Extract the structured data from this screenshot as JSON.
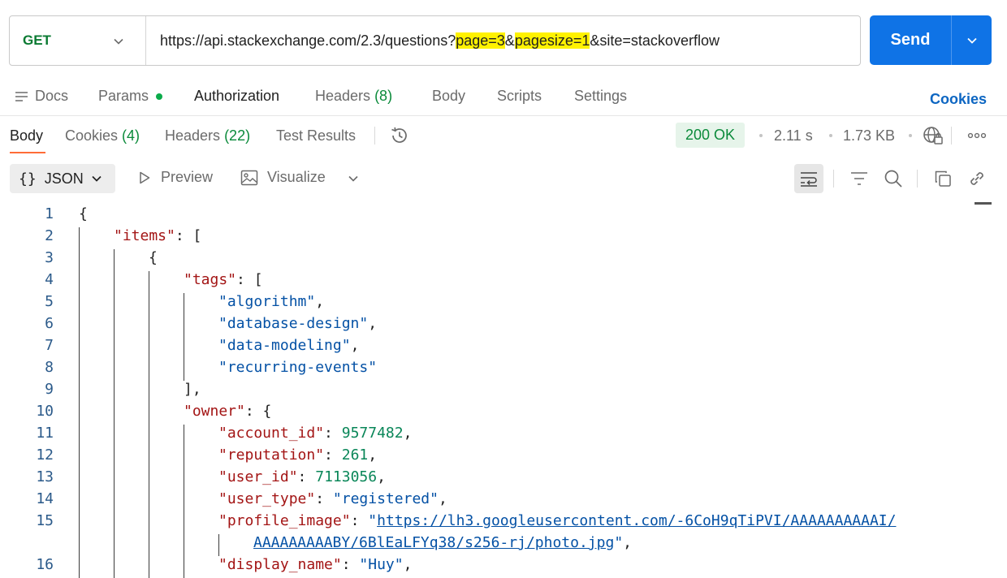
{
  "request": {
    "method": "GET",
    "url_parts": [
      {
        "text": "https://api.stackexchange.com/2.3/questions?",
        "hl": false
      },
      {
        "text": "page=3",
        "hl": true
      },
      {
        "text": "&",
        "hl": false
      },
      {
        "text": "pagesize=1",
        "hl": true
      },
      {
        "text": "&site=stackoverflow",
        "hl": false
      }
    ],
    "send_label": "Send"
  },
  "request_tabs": {
    "docs": "Docs",
    "params": "Params",
    "authorization": "Authorization",
    "headers": "Headers",
    "headers_count": "(8)",
    "body": "Body",
    "scripts": "Scripts",
    "settings": "Settings",
    "cookies": "Cookies"
  },
  "response_tabs": {
    "body": "Body",
    "cookies": "Cookies",
    "cookies_count": "(4)",
    "headers": "Headers",
    "headers_count": "(22)",
    "test_results": "Test Results"
  },
  "status": {
    "code": "200 OK",
    "time": "2.11 s",
    "size": "1.73 KB"
  },
  "toolbar": {
    "format": "JSON",
    "preview": "Preview",
    "visualize": "Visualize"
  },
  "colors": {
    "accent": "#0f73e6",
    "status_ok": "#0a8a3a",
    "highlight": "#fff200",
    "active_tab": "#ff6c37"
  },
  "code_lines": [
    {
      "n": "1",
      "depth": 0,
      "tokens": [
        [
          "p",
          "{"
        ]
      ]
    },
    {
      "n": "2",
      "depth": 1,
      "tokens": [
        [
          "k",
          "\"items\""
        ],
        [
          "p",
          ": ["
        ]
      ]
    },
    {
      "n": "3",
      "depth": 2,
      "tokens": [
        [
          "p",
          "{"
        ]
      ]
    },
    {
      "n": "4",
      "depth": 3,
      "tokens": [
        [
          "k",
          "\"tags\""
        ],
        [
          "p",
          ": ["
        ]
      ]
    },
    {
      "n": "5",
      "depth": 4,
      "tokens": [
        [
          "s",
          "\"algorithm\""
        ],
        [
          "p",
          ","
        ]
      ]
    },
    {
      "n": "6",
      "depth": 4,
      "tokens": [
        [
          "s",
          "\"database-design\""
        ],
        [
          "p",
          ","
        ]
      ]
    },
    {
      "n": "7",
      "depth": 4,
      "tokens": [
        [
          "s",
          "\"data-modeling\""
        ],
        [
          "p",
          ","
        ]
      ]
    },
    {
      "n": "8",
      "depth": 4,
      "tokens": [
        [
          "s",
          "\"recurring-events\""
        ]
      ]
    },
    {
      "n": "9",
      "depth": 3,
      "tokens": [
        [
          "p",
          "],"
        ]
      ]
    },
    {
      "n": "10",
      "depth": 3,
      "tokens": [
        [
          "k",
          "\"owner\""
        ],
        [
          "p",
          ": {"
        ]
      ]
    },
    {
      "n": "11",
      "depth": 4,
      "tokens": [
        [
          "k",
          "\"account_id\""
        ],
        [
          "p",
          ": "
        ],
        [
          "n",
          "9577482"
        ],
        [
          "p",
          ","
        ]
      ]
    },
    {
      "n": "12",
      "depth": 4,
      "tokens": [
        [
          "k",
          "\"reputation\""
        ],
        [
          "p",
          ": "
        ],
        [
          "n",
          "261"
        ],
        [
          "p",
          ","
        ]
      ]
    },
    {
      "n": "13",
      "depth": 4,
      "tokens": [
        [
          "k",
          "\"user_id\""
        ],
        [
          "p",
          ": "
        ],
        [
          "n",
          "7113056"
        ],
        [
          "p",
          ","
        ]
      ]
    },
    {
      "n": "14",
      "depth": 4,
      "tokens": [
        [
          "k",
          "\"user_type\""
        ],
        [
          "p",
          ": "
        ],
        [
          "s",
          "\"registered\""
        ],
        [
          "p",
          ","
        ]
      ]
    },
    {
      "n": "15",
      "depth": 4,
      "tokens": [
        [
          "k",
          "\"profile_image\""
        ],
        [
          "p",
          ": "
        ],
        [
          "s",
          "\""
        ],
        [
          "u",
          "https://lh3.googleusercontent.com/-6CoH9qTiPVI/AAAAAAAAAAI/"
        ]
      ]
    },
    {
      "n": "",
      "depth": 5,
      "tokens": [
        [
          "u",
          "AAAAAAAAABY/6BlEaLFYq38/s256-rj/photo.jpg"
        ],
        [
          "s",
          "\""
        ],
        [
          "p",
          ","
        ]
      ]
    },
    {
      "n": "16",
      "depth": 4,
      "tokens": [
        [
          "k",
          "\"display_name\""
        ],
        [
          "p",
          ": "
        ],
        [
          "s",
          "\"Huy\""
        ],
        [
          "p",
          ","
        ]
      ]
    }
  ]
}
